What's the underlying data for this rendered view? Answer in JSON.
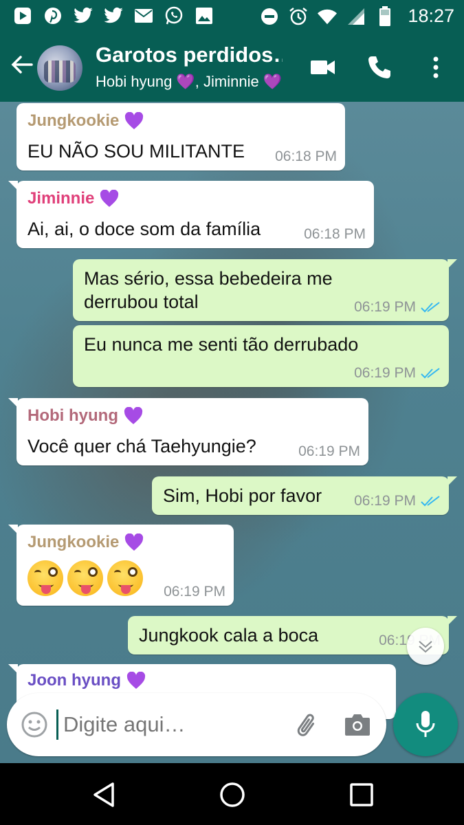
{
  "status_bar": {
    "time": "18:27",
    "left_icons": [
      "play-store-icon",
      "pinterest-icon",
      "twitter-icon",
      "twitter-icon",
      "mail-icon",
      "whatsapp-icon",
      "image-icon"
    ],
    "right_icons": [
      "do-not-disturb-icon",
      "alarm-icon",
      "wifi-icon",
      "signal-icon",
      "battery-icon"
    ]
  },
  "header": {
    "title": "Garotos perdidos…",
    "subtitle": "Hobi hyung 💜, Jiminnie 💜",
    "colors": {
      "bar": "#075E54",
      "accent": "#128C7E"
    }
  },
  "messages": [
    {
      "dir": "in",
      "sender": "Jungkookie",
      "sender_color": "#b59a72",
      "text": "EU NÃO SOU MILITANTE",
      "time": "06:18 PM"
    },
    {
      "dir": "in",
      "sender": "Jiminnie",
      "sender_color": "#e0407a",
      "text": "Ai, ai, o doce som da família",
      "time": "06:18 PM"
    },
    {
      "dir": "out",
      "text_lines": [
        "Mas sério, essa bebedeira me",
        "derrubou total"
      ],
      "time": "06:19 PM"
    },
    {
      "dir": "out",
      "text": "Eu nunca me senti tão derrubado",
      "time": "06:19 PM"
    },
    {
      "dir": "in",
      "sender": "Hobi hyung",
      "sender_color": "#b3697a",
      "text": "Você quer chá Taehyungie?",
      "time": "06:19 PM"
    },
    {
      "dir": "out",
      "text": "Sim, Hobi por favor",
      "time": "06:19 PM"
    },
    {
      "dir": "in",
      "sender": "Jungkookie",
      "sender_color": "#b59a72",
      "emoji_count": 3,
      "emoji_name": "winking-face-with-tongue",
      "time": "06:19 PM"
    },
    {
      "dir": "out",
      "text": "Jungkook cala a boca",
      "time": "06:19 PM"
    },
    {
      "dir": "in",
      "sender": "Joon hyung",
      "sender_color": "#6a4fc4"
    }
  ],
  "composer": {
    "placeholder": "Digite aqui…"
  }
}
